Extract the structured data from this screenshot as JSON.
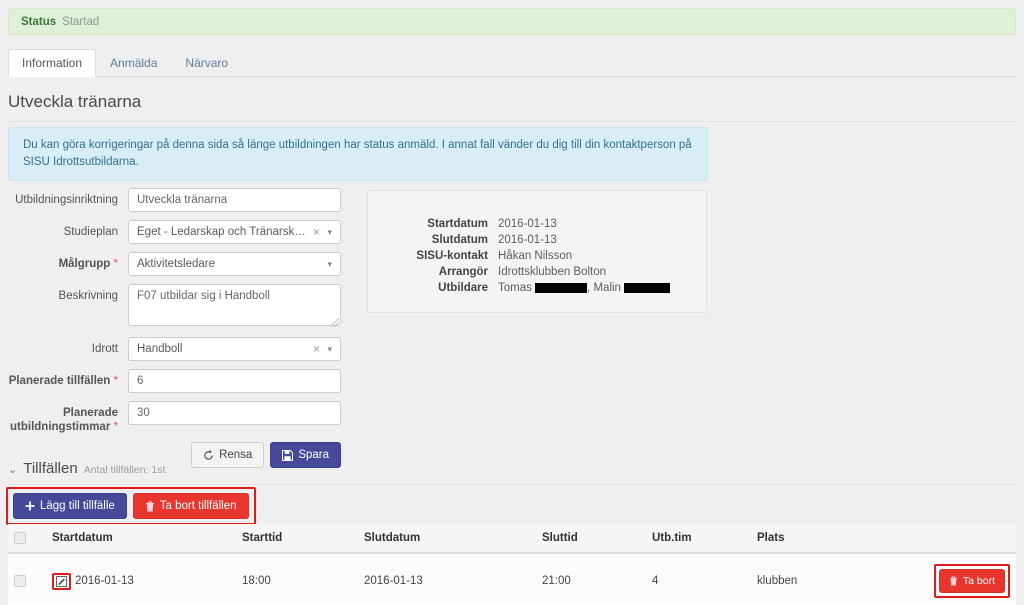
{
  "status_alert": {
    "label": "Status",
    "value": "Startad"
  },
  "tabs": [
    {
      "label": "Information",
      "active": true
    },
    {
      "label": "Anmälda",
      "active": false
    },
    {
      "label": "Närvaro",
      "active": false
    }
  ],
  "page_title": "Utveckla tränarna",
  "info_alert": {
    "text": "Du kan göra korrigeringar på denna sida så länge utbildningen har status anmäld. I annat fall vänder du dig till din kontaktperson på SISU Idrottsutbildarna."
  },
  "form": {
    "utbildningsinriktning": {
      "label": "Utbildningsinriktning",
      "value": "Utveckla tränarna",
      "required": false
    },
    "studieplan": {
      "label": "Studieplan",
      "value": "Eget - Ledarskap och Tränarskap",
      "required": false,
      "clear": "×",
      "caret": "▾"
    },
    "malgrupp": {
      "label": "Målgrupp",
      "value": "Aktivitetsledare",
      "required": true,
      "caret": "▾"
    },
    "beskrivning": {
      "label": "Beskrivning",
      "value": "F07 utbildar sig i Handboll",
      "required": false
    },
    "idrott": {
      "label": "Idrott",
      "value": "Handboll",
      "required": false,
      "clear": "×",
      "caret": "▾"
    },
    "planerade_tillfallen": {
      "label": "Planerade tillfällen",
      "value": "6",
      "required": true
    },
    "planerade_utbildningstimmar": {
      "label": "Planerade utbildningstimmar",
      "value": "30",
      "required": true
    },
    "required_marker": "*",
    "buttons": {
      "rensa": "Rensa",
      "spara": "Spara"
    }
  },
  "info_panel": {
    "rows": [
      {
        "label": "Startdatum",
        "value": "2016-01-13",
        "redacted": false
      },
      {
        "label": "Slutdatum",
        "value": "2016-01-13",
        "redacted": false
      },
      {
        "label": "SISU-kontakt",
        "value": "Håkan Nilsson",
        "redacted": false
      },
      {
        "label": "Arrangör",
        "value": "Idrottsklubben Bolton",
        "redacted": false
      },
      {
        "label": "Utbildare",
        "value": "Tomas ███████, Malin ███████",
        "redacted": true
      }
    ]
  },
  "tillfallen": {
    "chevron": "⌄",
    "title": "Tillfällen",
    "count_text": "Antal tillfällen: 1st",
    "add_button": "Lägg till tillfälle",
    "delete_button": "Ta bort tillfällen",
    "columns": [
      "",
      "Startdatum",
      "Starttid",
      "Slutdatum",
      "Sluttid",
      "Utb.tim",
      "Plats",
      ""
    ],
    "rows": [
      {
        "startdatum": "2016-01-13",
        "starttid": "18:00",
        "slutdatum": "2016-01-13",
        "sluttid": "21:00",
        "utb_tim": "4",
        "plats": "klubben",
        "row_delete_button": "Ta bort"
      }
    ]
  },
  "colors": {
    "success_bg": "#dff0d8",
    "info_bg": "#d9edf7",
    "primary": "#46499a",
    "danger": "#e8352e",
    "annotation": "#e01b1b"
  }
}
